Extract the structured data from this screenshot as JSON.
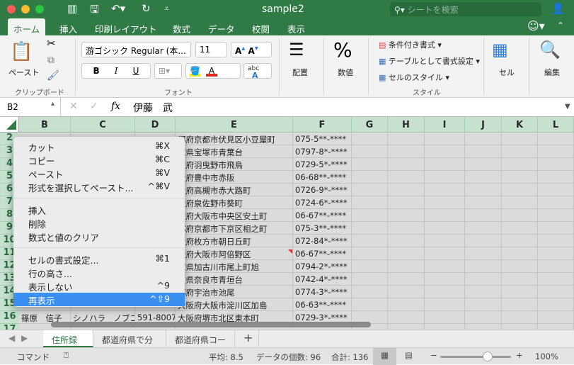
{
  "window": {
    "title": "sample2",
    "search_placeholder": "シートを検索"
  },
  "ribbon_tabs": [
    "ホーム",
    "挿入",
    "印刷レイアウト",
    "数式",
    "データ",
    "校閲",
    "表示"
  ],
  "ribbon": {
    "paste": "ペースト",
    "clipboard": "クリップボード",
    "font_name": "游ゴシック Regular (本...",
    "font_size": "11",
    "font_group": "フォント",
    "bold": "B",
    "italic": "I",
    "underline": "U",
    "font_color": "A",
    "phonetic": "abc",
    "alignment": "配置",
    "number": "数値",
    "number_symbol": "%",
    "conditional": "条件付き書式",
    "as_table": "テーブルとして書式設定",
    "cell_styles": "セルのスタイル",
    "styles_group": "スタイル",
    "cells": "セル",
    "editing": "編集",
    "colors": {
      "fill": "#f5e61a",
      "font": "#d92b20"
    }
  },
  "formula_bar": {
    "name_box": "B2",
    "fx": "fx",
    "value": "伊藤　武"
  },
  "columns": [
    "B",
    "C",
    "D",
    "E",
    "F",
    "G",
    "H",
    "I",
    "J",
    "K",
    "L"
  ],
  "rows": [
    {
      "n": "2",
      "E": "都府京都市伏見区小豆屋町",
      "F": "075-5**-****"
    },
    {
      "n": "3",
      "E": "庫県宝塚市青葉台",
      "F": "0797-8*-****"
    },
    {
      "n": "4",
      "E": "阪府羽曳野市飛鳥",
      "F": "0729-5*-****"
    },
    {
      "n": "5",
      "E": "阪府豊中市赤阪",
      "F": "06-68**-****"
    },
    {
      "n": "6",
      "E": "阪府高槻市赤大路町",
      "F": "0726-9*-****"
    },
    {
      "n": "7",
      "E": "阪府泉佐野市葵町",
      "F": "0724-6*-****"
    },
    {
      "n": "8",
      "E": "阪府大阪市中央区安土町",
      "F": "06-67**-****"
    },
    {
      "n": "9",
      "E": "都府京都市下京区相之町",
      "F": "075-3**-****"
    },
    {
      "n": "10",
      "E": "阪府枚方市朝日丘町",
      "F": "072-84*-****"
    },
    {
      "n": "11",
      "E": "阪府大阪市阿倍野区",
      "F": "06-67**-****"
    },
    {
      "n": "12",
      "E": "庫県加古川市尾上町旭",
      "F": "0794-2*-****"
    },
    {
      "n": "13",
      "E": "良県奈良市青垣台",
      "F": "0742-4*-****"
    },
    {
      "n": "14",
      "E": "都府宇治市池尾",
      "F": "0774-3*-****"
    },
    {
      "n": "15",
      "E": "大阪府大阪市淀川区加島",
      "F": "06-63**-****"
    },
    {
      "n": "16",
      "B": "篠原　信子",
      "C": "シノハラ　ノブコ",
      "D": "591-8007",
      "E": "大阪府堺市北区東本町",
      "F": "0729-3*-****"
    }
  ],
  "context_menu": [
    [
      {
        "label": "カット",
        "key": "⌘X"
      },
      {
        "label": "コピー",
        "key": "⌘C"
      },
      {
        "label": "ペースト",
        "key": "⌘V"
      },
      {
        "label": "形式を選択してペースト...",
        "key": "^⌘V"
      }
    ],
    [
      {
        "label": "挿入",
        "key": ""
      },
      {
        "label": "削除",
        "key": ""
      },
      {
        "label": "数式と値のクリア",
        "key": ""
      }
    ],
    [
      {
        "label": "セルの書式設定...",
        "key": "⌘1"
      },
      {
        "label": "行の高さ...",
        "key": ""
      },
      {
        "label": "表示しない",
        "key": "^9"
      },
      {
        "label": "再表示",
        "key": "^⇧9",
        "highlighted": true
      }
    ]
  ],
  "sheet_tabs": [
    "住所録",
    "都道府県で分割",
    "都道府県コード"
  ],
  "add_sheet": "+",
  "status": {
    "mode": "コマンド",
    "average": "平均: 8.5",
    "count": "データの個数: 96",
    "sum": "合計: 136",
    "zoom": "100%",
    "zoom_level": 100
  }
}
